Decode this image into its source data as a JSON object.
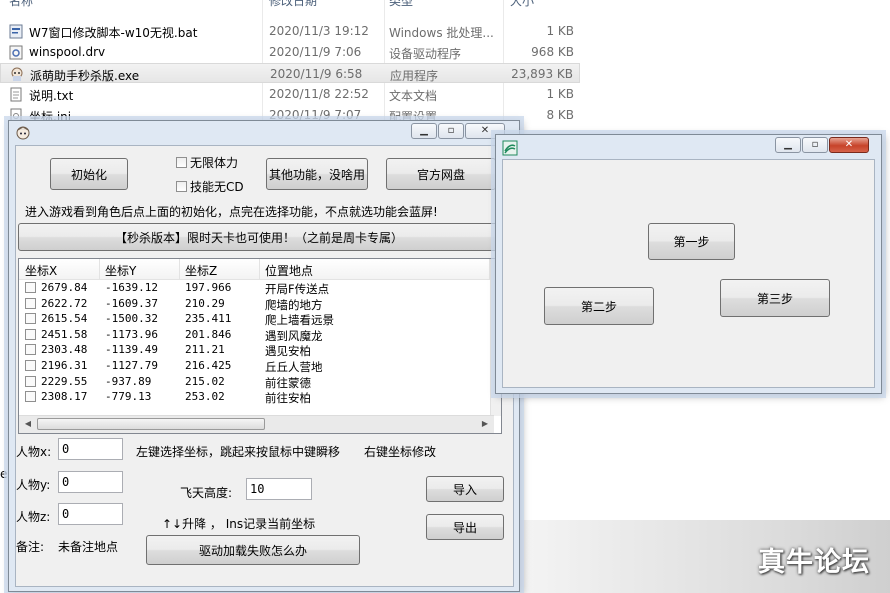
{
  "explorer": {
    "headers": {
      "name": "名称",
      "date": "修改日期",
      "type": "类型",
      "size": "大小"
    },
    "files": [
      {
        "icon": "bat-file-icon",
        "name": "W7窗口修改脚本-w10无视.bat",
        "date": "2020/11/3 19:12",
        "type": "Windows 批处理...",
        "size": "1 KB"
      },
      {
        "icon": "driver-file-icon",
        "name": "winspool.drv",
        "date": "2020/11/9 7:06",
        "type": "设备驱动程序",
        "size": "968 KB"
      },
      {
        "icon": "app-exe-icon",
        "name": "派萌助手秒杀版.exe",
        "date": "2020/11/9 6:58",
        "type": "应用程序",
        "size": "23,893 KB"
      },
      {
        "icon": "text-file-icon",
        "name": "说明.txt",
        "date": "2020/11/8 22:52",
        "type": "文本文档",
        "size": "1 KB"
      },
      {
        "icon": "ini-file-icon",
        "name": "坐标.ini",
        "date": "2020/11/9 7:07",
        "type": "配置设置",
        "size": "8 KB"
      }
    ],
    "left_edge_label": "e"
  },
  "main_window": {
    "buttons": {
      "init": "初始化",
      "other": "其他功能，没啥用",
      "netdisk": "官方网盘",
      "banner": "【秒杀版本】限时天卡也可使用！（之前是周卡专属）",
      "import": "导入",
      "export": "导出",
      "driver": "驱动加载失败怎么办"
    },
    "checkboxes": {
      "stamina": "无限体力",
      "cooldown": "技能无CD"
    },
    "instruction": "进入游戏看到角色后点上面的初始化，点完在选择功能，不点就选功能会蓝屏!",
    "table": {
      "columns": [
        "坐标X",
        "坐标Y",
        "坐标Z",
        "位置地点"
      ],
      "rows": [
        [
          "2679.84",
          "-1639.12",
          "197.966",
          "开局F传送点"
        ],
        [
          "2622.72",
          "-1609.37",
          "210.29",
          "爬墙的地方"
        ],
        [
          "2615.54",
          "-1500.32",
          "235.411",
          "爬上墙看远景"
        ],
        [
          "2451.58",
          "-1173.96",
          "201.846",
          "遇到风魔龙"
        ],
        [
          "2303.48",
          "-1139.49",
          "211.21",
          "遇见安柏"
        ],
        [
          "2196.31",
          "-1127.79",
          "216.425",
          "丘丘人营地"
        ],
        [
          "2229.55",
          "-937.89",
          "215.02",
          "前往蒙德"
        ],
        [
          "2308.17",
          "-779.13",
          "253.02",
          "前往安柏"
        ]
      ]
    },
    "player": {
      "x_label": "人物x:",
      "x_value": "0",
      "y_label": "人物y:",
      "y_value": "0",
      "z_label": "人物z:",
      "z_value": "0"
    },
    "hint_left": "左键选择坐标，跳起来按鼠标中键瞬移",
    "hint_right": "右键坐标修改",
    "fly_label": "飞天高度:",
    "fly_value": "10",
    "lift_hint": "↑↓升降 ， Ins记录当前坐标",
    "note_label": "备注:",
    "note_value": "未备注地点"
  },
  "step_window": {
    "buttons": {
      "step1": "第一步",
      "step2": "第二步",
      "step3": "第三步"
    }
  },
  "watermark": "真牛论坛"
}
